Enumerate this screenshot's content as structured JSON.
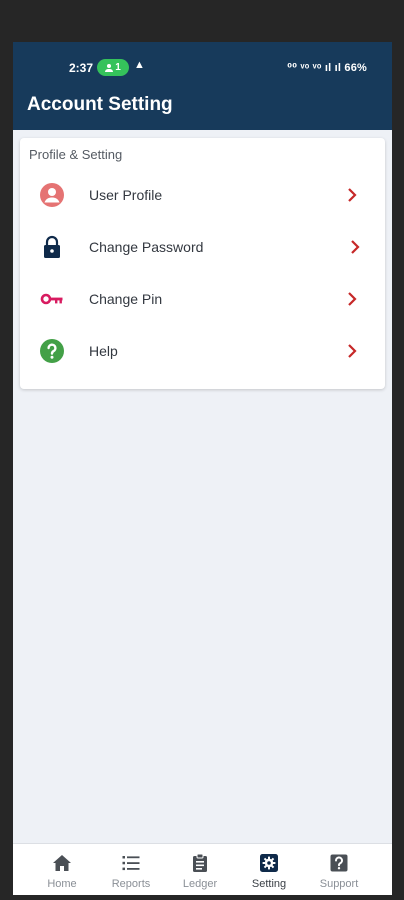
{
  "status_bar": {
    "time": "2:37",
    "badge": "1",
    "extra": "▲",
    "right": "⁰⁰ ᵛᵒ ᵛᵒ ıl ıl 66%"
  },
  "header": {
    "title": "Account Setting"
  },
  "section": {
    "title": "Profile & Setting",
    "items": [
      {
        "label": "User Profile",
        "icon": "user-profile-icon",
        "color": "#e57373"
      },
      {
        "label": "Change Password",
        "icon": "lock-icon",
        "color": "#0f2a4a"
      },
      {
        "label": "Change Pin",
        "icon": "key-icon",
        "color": "#d81b60"
      },
      {
        "label": "Help",
        "icon": "help-icon",
        "color": "#43a047"
      }
    ]
  },
  "bottom_nav": {
    "items": [
      {
        "label": "Home",
        "icon": "home-icon"
      },
      {
        "label": "Reports",
        "icon": "list-icon"
      },
      {
        "label": "Ledger",
        "icon": "clipboard-icon"
      },
      {
        "label": "Setting",
        "icon": "gear-icon",
        "active": true
      },
      {
        "label": "Support",
        "icon": "question-icon"
      }
    ]
  },
  "colors": {
    "primary": "#173a5b",
    "chevron": "#c62828",
    "status_pill": "#35c25b",
    "background": "#eef1f6"
  }
}
